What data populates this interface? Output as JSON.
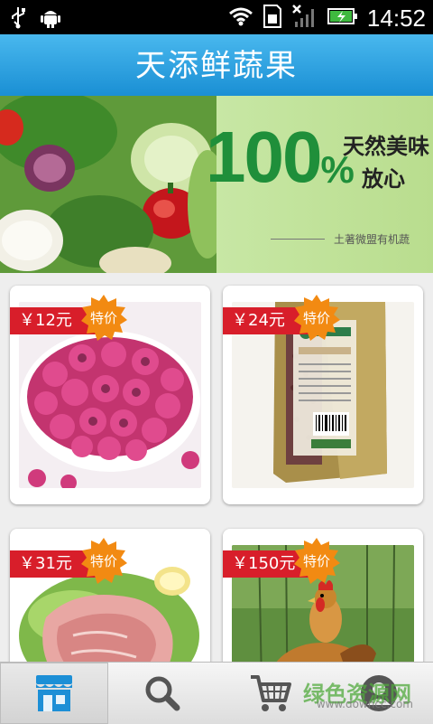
{
  "status_bar": {
    "time": "14:52",
    "icons": [
      "usb-icon",
      "android-icon",
      "wifi-icon",
      "sim-icon",
      "signal-icon",
      "battery-charging-icon"
    ]
  },
  "header": {
    "title": "天添鲜蔬果"
  },
  "banner": {
    "headline_number": "100",
    "headline_percent": "%",
    "tagline_line1": "天然美味",
    "tagline_line2": "放心",
    "credit": "土著微盟有机蔬",
    "pager": {
      "count": 2,
      "active_index": 0
    }
  },
  "products": [
    {
      "price": "￥12元",
      "badge": "特价",
      "item": "dried-rose-buds"
    },
    {
      "price": "￥24元",
      "badge": "特价",
      "item": "red-bean-pack"
    },
    {
      "price": "￥31元",
      "badge": "特价",
      "item": "pork-meat"
    },
    {
      "price": "￥150元",
      "badge": "特价",
      "item": "free-range-chicken"
    }
  ],
  "tabbar": {
    "tabs": [
      {
        "name": "store",
        "icon": "store-icon",
        "active": true
      },
      {
        "name": "search",
        "icon": "search-icon",
        "active": false
      },
      {
        "name": "cart",
        "icon": "cart-icon",
        "active": false
      },
      {
        "name": "account",
        "icon": "user-icon",
        "active": false
      }
    ]
  },
  "watermark": {
    "line1": "绿色资源网",
    "line2": "www.downcc.com"
  },
  "colors": {
    "title_bar": "#1a8fd4",
    "price_tag": "#d81e2a",
    "badge": "#f28a12",
    "banner_accent": "#1f8f3a"
  }
}
